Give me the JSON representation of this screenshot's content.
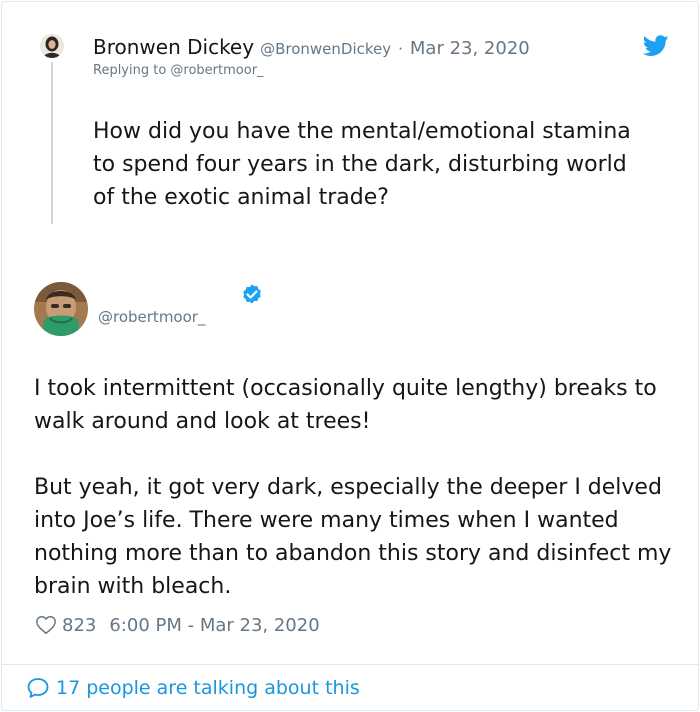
{
  "parent_tweet": {
    "display_name": "Bronwen Dickey",
    "handle": "@BronwenDickey",
    "separator": "·",
    "date": "Mar 23, 2020",
    "replying_to": "Replying to @robertmoor_",
    "text": "How did you have the mental/emotional stamina to spend four years in the dark, disturbing world of the exotic animal trade?"
  },
  "main_tweet": {
    "handle": "@robertmoor_",
    "paragraphs": [
      "I took intermittent (occasionally quite lengthy) breaks to walk around and look at trees!",
      "But yeah, it got very dark, especially the deeper I delved into Joe’s life. There were many times when I wanted nothing more than to abandon this story and disinfect my brain with bleach."
    ],
    "like_count": "823",
    "timestamp": "6:00 PM - Mar 23, 2020"
  },
  "footer": {
    "talking_text": "17 people are talking about this"
  },
  "icons": {
    "brand": "twitter-bird-icon",
    "verified": "verified-badge-icon",
    "like": "heart-icon",
    "reply": "speech-bubble-icon"
  },
  "colors": {
    "twitter_blue": "#1da1f2",
    "link_blue": "#1b95e0",
    "secondary_text": "#657786",
    "primary_text": "#14171a",
    "border": "#e1e8ed"
  }
}
